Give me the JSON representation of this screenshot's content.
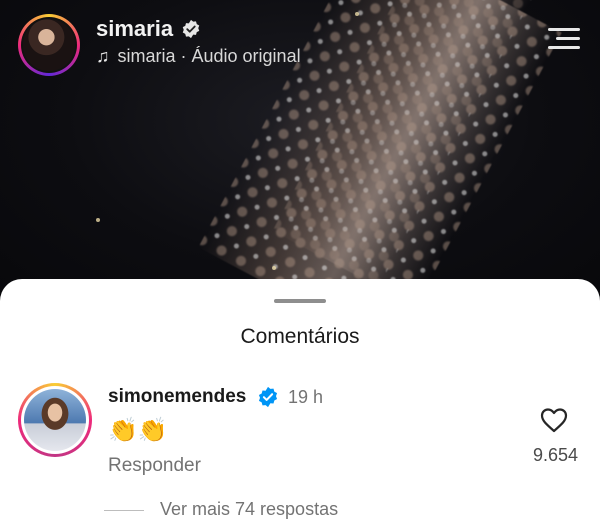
{
  "header": {
    "username": "simaria",
    "audio_text": "simaria · Áudio original",
    "icons": {
      "avatar": "profile-avatar",
      "verified": "verified-badge-icon",
      "audio": "music-note-icon",
      "menu": "menu-icon"
    }
  },
  "comments_sheet": {
    "title": "Comentários",
    "comment": {
      "username": "simonemendes",
      "time": "19 h",
      "text": "👏👏",
      "reply_label": "Responder",
      "like_count": "9.654",
      "view_more": "Ver mais 74 respostas"
    }
  },
  "colors": {
    "verified_blue": "#0095f6",
    "story_ring": [
      "#f9ce34",
      "#ee2a7b",
      "#6228d7"
    ],
    "sheet_bg": "#ffffff",
    "muted_text": "#737373"
  }
}
